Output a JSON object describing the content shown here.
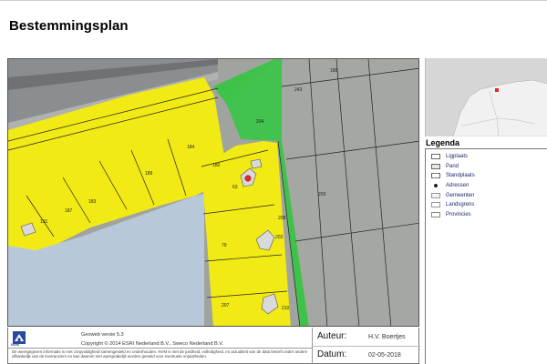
{
  "page": {
    "title": "Bestemmingsplan"
  },
  "map": {
    "parcel_labels": [
      "188",
      "243",
      "204",
      "203",
      "184",
      "189",
      "180",
      "183",
      "187",
      "191",
      "63",
      "79",
      "203",
      "207",
      "208",
      "210"
    ],
    "colors": {
      "residential": "#f2ea14",
      "green": "#3ec24a",
      "water": "#b7c8d8",
      "road": "#7f8285",
      "terrain": "#a1a49e",
      "marker": "#e8262a"
    }
  },
  "legend": {
    "title": "Legenda",
    "items": [
      "Ligplaats",
      "Pand",
      "Standplaats",
      "Adressen",
      "Gemeenten",
      "Landsgrens",
      "Provincies"
    ]
  },
  "footer": {
    "logo_text": "NVM",
    "geoweb": "Geoweb versie 5.3",
    "copyright": "Copyright © 2014 ESRI Nederland B.V., Sweco Nederland B.V.",
    "disclaimer": "De weergegeven informatie is met zorgvuldigheid samengesteld en onderhouden. NVM is niet de juistheid, volledigheid, en actualiteit van de data betreft onder andere afhankelijk van de leveranciers en kan daarom niet aansprakelijk worden gesteld voor eventuele onjuistheden.",
    "auteur_label": "Auteur:",
    "auteur_value": "H.V. Boertjes",
    "datum_label": "Datum:",
    "datum_value": "02-05-2018"
  }
}
